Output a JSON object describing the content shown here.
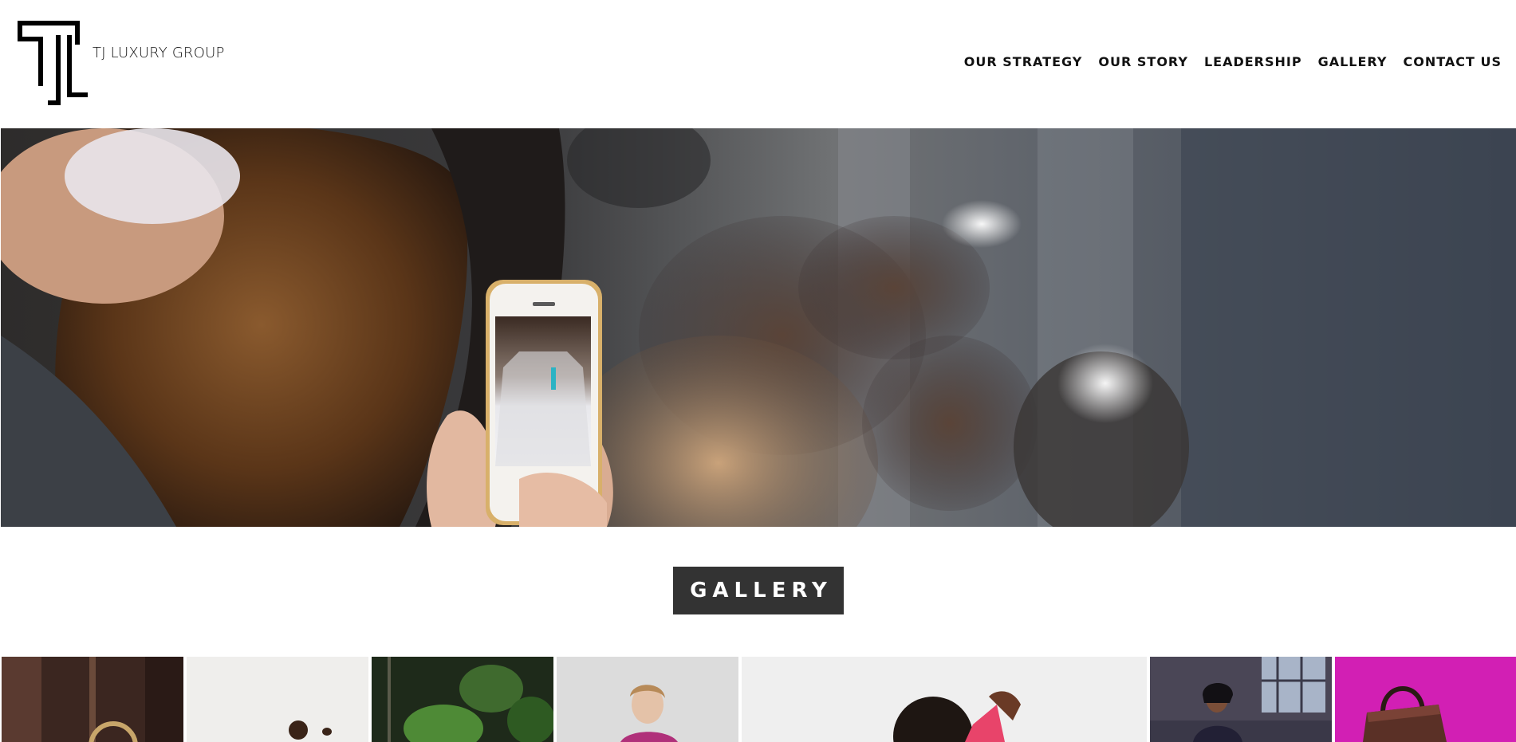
{
  "brand": {
    "name": "TJ LUXURY GROUP",
    "logo_icon": "tj-monogram-icon"
  },
  "nav": {
    "items": [
      {
        "label": "OUR STRATEGY"
      },
      {
        "label": "OUR STORY"
      },
      {
        "label": "LEADERSHIP"
      },
      {
        "label": "GALLERY"
      },
      {
        "label": "CONTACT US"
      }
    ]
  },
  "section": {
    "title": "GALLERY"
  },
  "colors": {
    "title_box": "#333333",
    "text": "#111111",
    "background": "#ffffff",
    "tile_magenta": "#d21fb4"
  }
}
